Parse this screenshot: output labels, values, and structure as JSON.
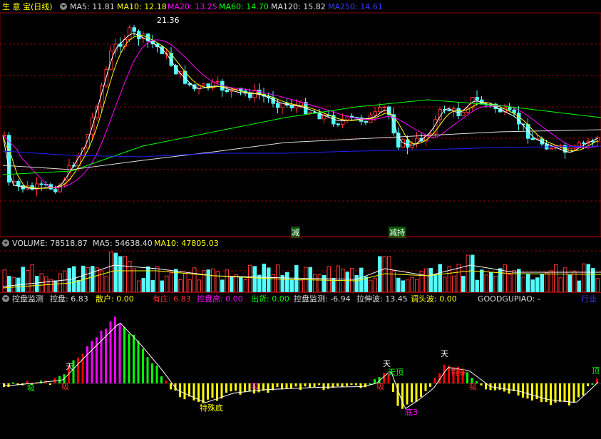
{
  "price_panel": {
    "title": "生 意 宝(日线)",
    "ma_labels": [
      {
        "text": "MA5: 11.81",
        "color": "#ffffff"
      },
      {
        "text": "MA10: 12.18",
        "color": "#ffff00"
      },
      {
        "text": "MA20: 13.25",
        "color": "#ff00ff"
      },
      {
        "text": "MA60: 14.70",
        "color": "#00ff00"
      },
      {
        "text": "MA120: 15.82",
        "color": "#e0e0e0"
      },
      {
        "text": "MA250: 14.61",
        "color": "#0000ff"
      }
    ],
    "high_marker": "21.36",
    "signal_labels": [
      "减",
      "减持"
    ]
  },
  "volume_panel": {
    "labels": [
      {
        "text": "VOLUME: 78518.87",
        "color": "#ffffff"
      },
      {
        "text": "MA5: 54638.40",
        "color": "#ffffff"
      },
      {
        "text": "MA10: 47805.03",
        "color": "#ffff00"
      }
    ]
  },
  "indicator_panel": {
    "labels": [
      {
        "text": "控盘监测",
        "color": "#ffffff"
      },
      {
        "text": "控盘: 6.83",
        "color": "#ffffff"
      },
      {
        "text": "散户: 0.00",
        "color": "#ffff00"
      },
      {
        "text": "有庄: 6.83",
        "color": "#ff0000"
      },
      {
        "text": "控盘高: 0.00",
        "color": "#ff00ff"
      },
      {
        "text": "出货: 0.00",
        "color": "#00ff00"
      },
      {
        "text": "控盘监测: -6.94",
        "color": "#ffffff"
      },
      {
        "text": "拉伸波: 13.45",
        "color": "#ffffff"
      },
      {
        "text": "调头波: 0.00",
        "color": "#ffff00"
      },
      {
        "text": "GOODGUPIAO: -",
        "color": "#ffffff"
      },
      {
        "text": "行业",
        "color": "#0000ff"
      }
    ],
    "annotations": [
      "吸",
      "天",
      "吸",
      "特殊底",
      "吸",
      "天",
      "天顶",
      "吸",
      "底3",
      "天",
      "特殊",
      "吸",
      "顶"
    ]
  },
  "colors": {
    "up": "#ff3232",
    "down": "#54ffff",
    "grid": "#8b0000"
  }
}
